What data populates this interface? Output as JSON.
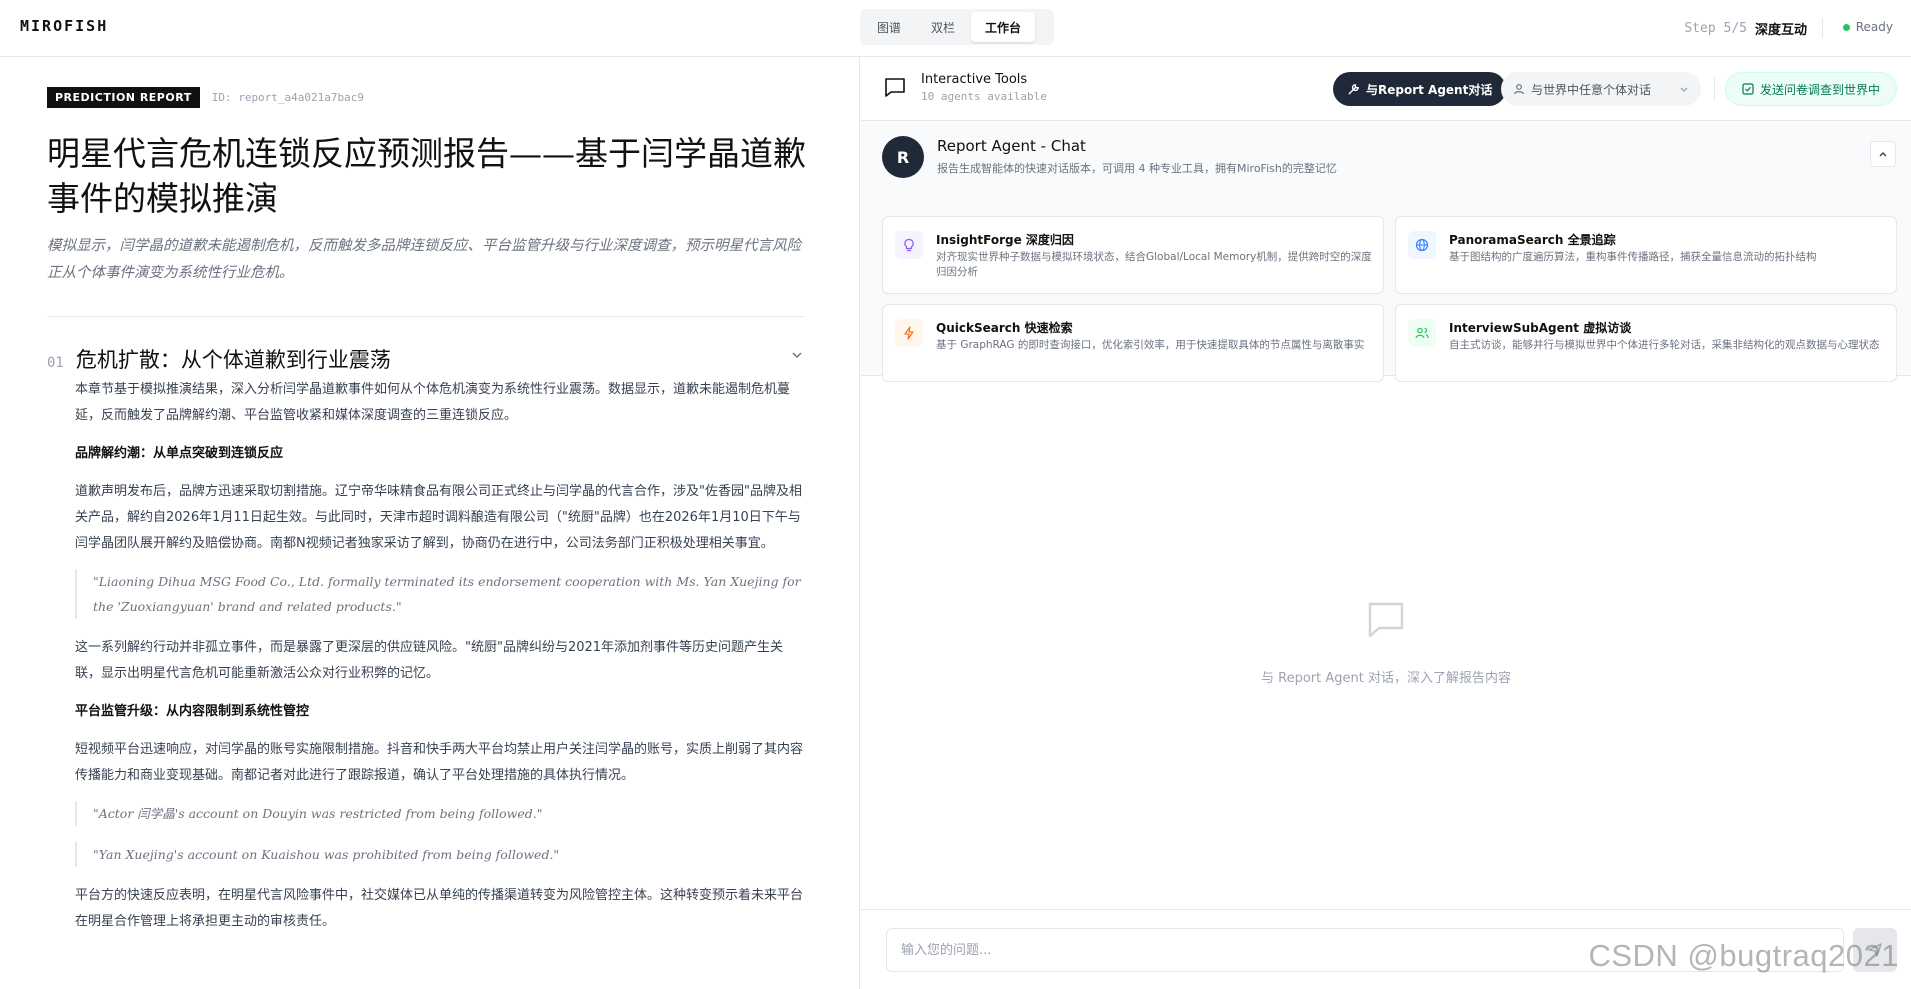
{
  "brand": "MIROFISH",
  "view_tabs": [
    {
      "label": "图谱",
      "active": false
    },
    {
      "label": "双栏",
      "active": false
    },
    {
      "label": "工作台",
      "active": true
    }
  ],
  "step": {
    "num": "Step 5/5",
    "name": "深度互动"
  },
  "status": {
    "label": "Ready",
    "color": "#22c55e"
  },
  "report": {
    "badge": "PREDICTION REPORT",
    "id": "ID: report_a4a021a7bac9",
    "title": "明星代言危机连锁反应预测报告——基于闫学晶道歉事件的模拟推演",
    "summary": "模拟显示，闫学晶的道歉未能遏制危机，反而触发多品牌连锁反应、平台监管升级与行业深度调查，预示明星代言风险正从个体事件演变为系统性行业危机。",
    "section": {
      "num": "01",
      "title": "危机扩散：从个体道歉到行业震荡",
      "p1": "本章节基于模拟推演结果，深入分析闫学晶道歉事件如何从个体危机演变为系统性行业震荡。数据显示，道歉未能遏制危机蔓延，反而触发了品牌解约潮、平台监管收紧和媒体深度调查的三重连锁反应。",
      "h1": "品牌解约潮：从单点突破到连锁反应",
      "p2": "道歉声明发布后，品牌方迅速采取切割措施。辽宁帝华味精食品有限公司正式终止与闫学晶的代言合作，涉及\"佐香园\"品牌及相关产品，解约自2026年1月11日起生效。与此同时，天津市超时调料酿造有限公司（\"统厨\"品牌）也在2026年1月10日下午与闫学晶团队展开解约及赔偿协商。南都N视频记者独家采访了解到，协商仍在进行中，公司法务部门正积极处理相关事宜。",
      "q1": "\"Liaoning Dihua MSG Food Co., Ltd. formally terminated its endorsement cooperation with Ms. Yan Xuejing for the 'Zuoxiangyuan' brand and related products.\"",
      "p3": "这一系列解约行动并非孤立事件，而是暴露了更深层的供应链风险。\"统厨\"品牌纠纷与2021年添加剂事件等历史问题产生关联，显示出明星代言危机可能重新激活公众对行业积弊的记忆。",
      "h2": "平台监管升级：从内容限制到系统性管控",
      "p4": "短视频平台迅速响应，对闫学晶的账号实施限制措施。抖音和快手两大平台均禁止用户关注闫学晶的账号，实质上削弱了其内容传播能力和商业变现基础。南都记者对此进行了跟踪报道，确认了平台处理措施的具体执行情况。",
      "q2": "\"Actor 闫学晶's account on Douyin was restricted from being followed.\"",
      "q3": "\"Yan Xuejing's account on Kuaishou was prohibited from being followed.\"",
      "p5": "平台方的快速反应表明，在明星代言风险事件中，社交媒体已从单纯的传播渠道转变为风险管控主体。这种转变预示着未来平台在明星合作管理上将承担更主动的审核责任。"
    }
  },
  "tools_bar": {
    "title": "Interactive Tools",
    "subtitle": "10 agents available",
    "agent_btn": "与Report Agent对话",
    "world_btn": "与世界中任意个体对话",
    "survey_btn": "发送问卷调查到世界中"
  },
  "agent": {
    "avatar": "R",
    "name": "Report Agent - Chat",
    "desc": "报告生成智能体的快速对话版本，可调用 4 种专业工具，拥有MiroFish的完整记忆",
    "tools": [
      {
        "name": "InsightForge 深度归因",
        "desc": "对齐现实世界种子数据与模拟环境状态，结合Global/Local Memory机制，提供跨时空的深度归因分析",
        "icon": "lightbulb-icon",
        "color": "#8b5cf6"
      },
      {
        "name": "PanoramaSearch 全景追踪",
        "desc": "基于图结构的广度遍历算法，重构事件传播路径，捕获全量信息流动的拓扑结构",
        "icon": "globe-icon",
        "color": "#3b82f6"
      },
      {
        "name": "QuickSearch 快速检索",
        "desc": "基于 GraphRAG 的即时查询接口，优化索引效率，用于快速提取具体的节点属性与离散事实",
        "icon": "lightning-icon",
        "color": "#f97316"
      },
      {
        "name": "InterviewSubAgent 虚拟访谈",
        "desc": "自主式访谈，能够并行与模拟世界中个体进行多轮对话，采集非结构化的观点数据与心理状态",
        "icon": "users-icon",
        "color": "#22c55e"
      }
    ]
  },
  "empty_text": "与 Report Agent 对话，深入了解报告内容",
  "chat": {
    "placeholder": "输入您的问题..."
  },
  "watermark": "CSDN @bugtraq2021"
}
